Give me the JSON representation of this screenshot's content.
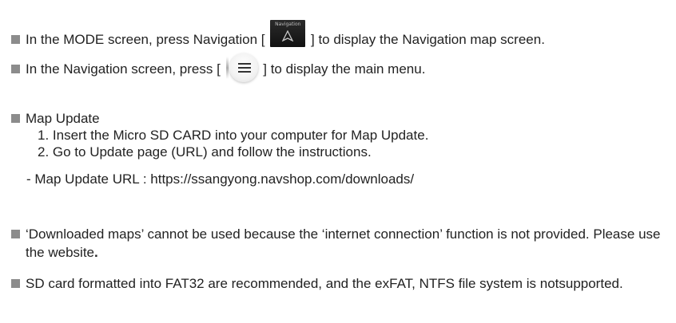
{
  "intro": {
    "line1_before": "In the MODE screen, press Navigation [",
    "line1_icon_label": "Navigation",
    "line1_after": "] to display the Navigation map screen.",
    "line2_before": "In the Navigation screen, press [",
    "line2_after": "] to display the main menu."
  },
  "map_update": {
    "heading": "Map Update",
    "steps": [
      "1. Insert the Micro SD CARD into your computer for Map Update.",
      "2. Go to Update page (URL) and follow the instructions."
    ],
    "url_line": "- Map Update URL : https://ssangyong.navshop.com/downloads/"
  },
  "notes": {
    "downloaded_maps": "‘Downloaded maps’ cannot be used because the ‘internet connection’ function is not provided. Please use the website",
    "downloaded_maps_end": ".",
    "sd_card": "SD card formatted into FAT32 are recommended, and the exFAT, NTFS file system is notsupported."
  },
  "colors": {
    "text": "#222222",
    "bullet": "#8c8c8c"
  }
}
